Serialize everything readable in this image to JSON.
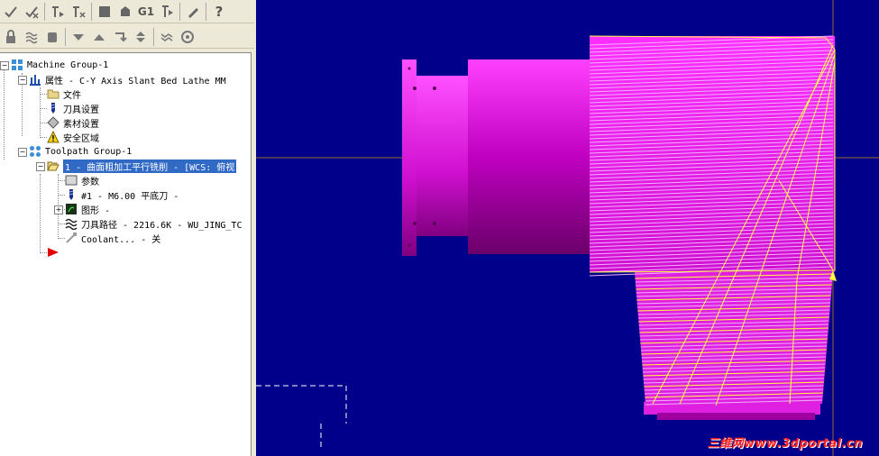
{
  "tree": {
    "machine_group": "Machine Group-1",
    "properties": "属性 - C-Y Axis Slant Bed Lathe MM",
    "files": "文件",
    "tool_settings": "刀具设置",
    "stock_setup": "素材设置",
    "safety_zone": "安全区域",
    "toolpath_group": "Toolpath Group-1",
    "operation": "1 - 曲面粗加工平行铣削 - [WCS: 俯视",
    "params": "参数",
    "tool": "#1 - M6.00 平底刀 -",
    "geometry": "图形 -",
    "toolpath": "刀具路径 - 2216.6K - WU_JING_TC",
    "coolant": "Coolant... - 关"
  },
  "toolbar": {
    "icons_row1": [
      "select-check-icon",
      "deselect-check-icon",
      "toolpath-forward-icon",
      "toolpath-clear-icon",
      "square-icon",
      "gear-icon",
      "g1-icon",
      "post-arrow-icon",
      "edit-icon",
      "help-icon"
    ],
    "g1_label": "G1",
    "help_label": "?"
  },
  "watermark": "三维网www.3dportal.cn",
  "colors": {
    "viewport_bg": "#00008a",
    "part": "#e010e0",
    "toolpath_light": "#f0b0ff",
    "toolpath_yellow": "#ffff40",
    "selection": "#316ac5"
  }
}
